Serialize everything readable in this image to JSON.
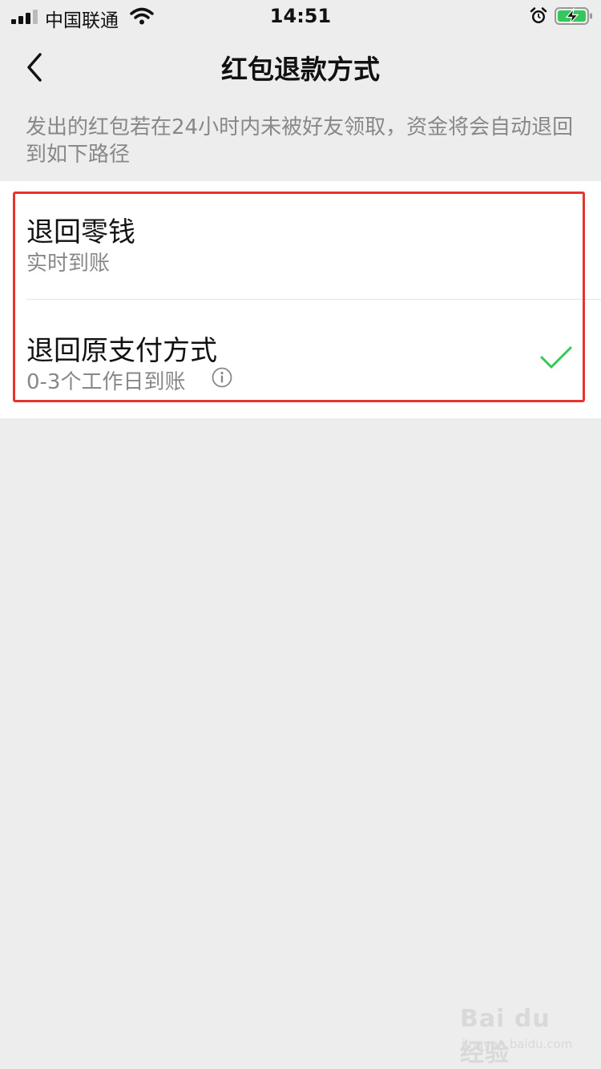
{
  "status_bar": {
    "carrier": "中国联通",
    "time": "14:51"
  },
  "nav": {
    "title": "红包退款方式"
  },
  "description": "发出的红包若在24小时内未被好友领取，资金将会自动退回到如下路径",
  "options": [
    {
      "title": "退回零钱",
      "subtitle": "实时到账",
      "selected": false
    },
    {
      "title": "退回原支付方式",
      "subtitle": "0-3个工作日到账",
      "selected": true
    }
  ],
  "colors": {
    "check": "#34c759",
    "highlight": "#e8322e",
    "battery_fill": "#34c759"
  },
  "watermark": {
    "brand": "Bai du 经验",
    "url": "jingyan.baidu.com"
  }
}
